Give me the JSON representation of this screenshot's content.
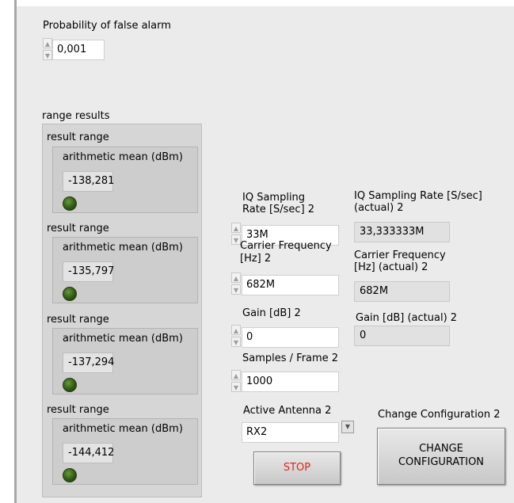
{
  "false_alarm": {
    "label": "Probability of false alarm",
    "value": "0,001"
  },
  "range_results": {
    "label": "range results",
    "items": [
      {
        "title": "result range",
        "mean_label": "arithmetic  mean (dBm)",
        "value": "-138,281"
      },
      {
        "title": "result range",
        "mean_label": "arithmetic  mean (dBm)",
        "value": "-135,797"
      },
      {
        "title": "result range",
        "mean_label": "arithmetic  mean (dBm)",
        "value": "-137,294"
      },
      {
        "title": "result range",
        "mean_label": "arithmetic  mean (dBm)",
        "value": "-144,412"
      }
    ]
  },
  "iq_rate": {
    "label": "IQ Sampling Rate [S/sec] 2",
    "value": "33M"
  },
  "iq_rate_actual": {
    "label": "IQ Sampling Rate [S/sec] (actual) 2",
    "value": "33,333333M"
  },
  "carrier": {
    "label": "Carrier Frequency [Hz] 2",
    "value": "682M"
  },
  "carrier_actual": {
    "label": "Carrier Frequency [Hz] (actual) 2",
    "value": "682M"
  },
  "gain": {
    "label": "Gain [dB] 2",
    "value": "0"
  },
  "gain_actual": {
    "label": "Gain [dB] (actual) 2",
    "value": "0"
  },
  "samples": {
    "label": "Samples / Frame 2",
    "value": "1000"
  },
  "antenna": {
    "label": "Active Antenna 2",
    "value": "RX2"
  },
  "stop_button": {
    "label": "STOP",
    "color": "#e0231b"
  },
  "change_config": {
    "label": "Change Configuration 2",
    "button_label_1": "CHANGE",
    "button_label_2": "CONFIGURATION"
  }
}
